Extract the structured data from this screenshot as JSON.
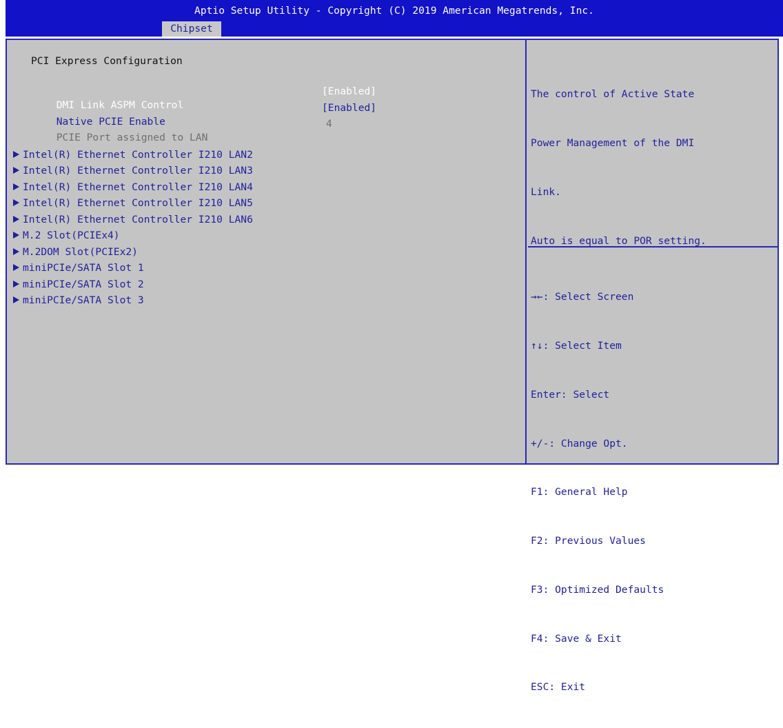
{
  "window": {
    "title": "Aptio Setup Utility - Copyright (C) 2019 American Megatrends, Inc.",
    "active_tab": "Chipset"
  },
  "main": {
    "section_title": "PCI Express Configuration",
    "settings": [
      {
        "label": "DMI Link ASPM Control",
        "value": "[Enabled]",
        "state": "selected"
      },
      {
        "label": "Native PCIE Enable",
        "value": "[Enabled]",
        "state": "normal"
      },
      {
        "label": "PCIE Port assigned to LAN",
        "value": "4",
        "state": "disabled"
      }
    ],
    "submenus": [
      {
        "label": "Intel(R) Ethernet Controller I210 LAN2"
      },
      {
        "label": "Intel(R) Ethernet Controller I210 LAN3"
      },
      {
        "label": "Intel(R) Ethernet Controller I210 LAN4"
      },
      {
        "label": "Intel(R) Ethernet Controller I210 LAN5"
      },
      {
        "label": "Intel(R) Ethernet Controller I210 LAN6"
      },
      {
        "label": "M.2 Slot(PCIEx4)"
      },
      {
        "label": "M.2DOM Slot(PCIEx2)"
      },
      {
        "label": "miniPCIe/SATA Slot 1"
      },
      {
        "label": "miniPCIe/SATA Slot 2"
      },
      {
        "label": "miniPCIe/SATA Slot 3"
      }
    ]
  },
  "help": {
    "lines": [
      "The control of Active State",
      "Power Management of the DMI",
      "Link.",
      "Auto is equal to POR setting."
    ],
    "keys": [
      "→←: Select Screen",
      "↑↓: Select Item",
      "Enter: Select",
      "+/-: Change Opt.",
      "F1: General Help",
      "F2: Previous Values",
      "F3: Optimized Defaults",
      "F4: Save & Exit",
      "ESC: Exit"
    ]
  },
  "colors": {
    "header_bg": "#1212c8",
    "panel_bg": "#c4c4c4",
    "text_blue": "#1f1f9f",
    "selected_text": "#ffffff",
    "disabled_text": "#6f6f6f"
  }
}
